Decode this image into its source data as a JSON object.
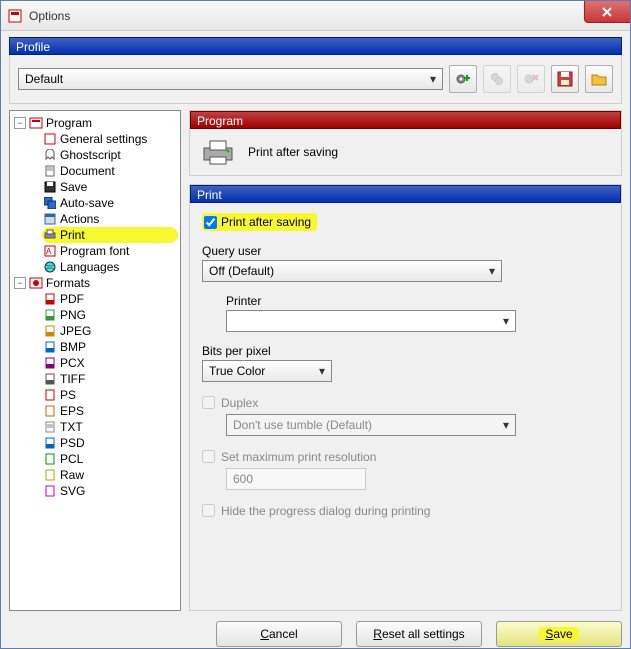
{
  "window": {
    "title": "Options"
  },
  "profile": {
    "header": "Profile",
    "selected": "Default"
  },
  "tree": {
    "program": {
      "label": "Program",
      "items": [
        "General settings",
        "Ghostscript",
        "Document",
        "Save",
        "Auto-save",
        "Actions",
        "Print",
        "Program font",
        "Languages"
      ]
    },
    "formats": {
      "label": "Formats",
      "items": [
        "PDF",
        "PNG",
        "JPEG",
        "BMP",
        "PCX",
        "TIFF",
        "PS",
        "EPS",
        "TXT",
        "PSD",
        "PCL",
        "Raw",
        "SVG"
      ]
    }
  },
  "program_section": {
    "header": "Program",
    "title": "Print after saving"
  },
  "print_section": {
    "header": "Print",
    "print_after_saving": "Print after saving",
    "print_after_saving_checked": true,
    "query_user_label": "Query user",
    "query_user_value": "Off (Default)",
    "printer_label": "Printer",
    "printer_value": "",
    "bits_label": "Bits per pixel",
    "bits_value": "True Color",
    "duplex_label": "Duplex",
    "duplex_value": "Don't use tumble (Default)",
    "maxres_label": "Set maximum print resolution",
    "maxres_value": "600",
    "hide_progress_label": "Hide the progress dialog during printing"
  },
  "buttons": {
    "cancel": "Cancel",
    "reset": "Reset all settings",
    "save": "Save"
  }
}
